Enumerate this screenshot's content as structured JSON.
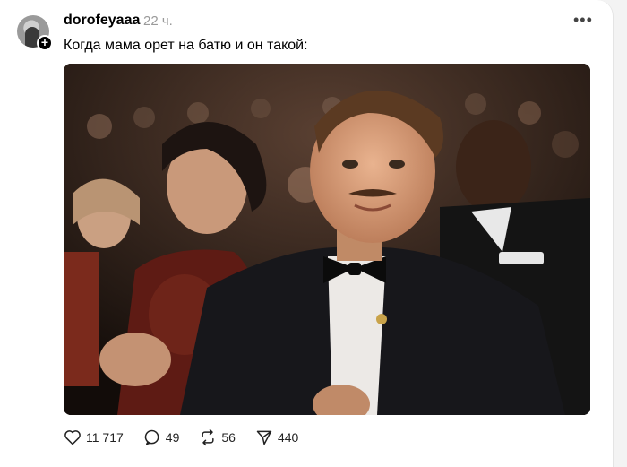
{
  "post": {
    "username": "dorofeyaaa",
    "time": "22 ч.",
    "text": "Когда мама орет на батю и он такой:",
    "more_icon": "more-horizontal-icon",
    "avatar_plus": "+",
    "image_icon": "photo-audience-scene"
  },
  "actions": {
    "likes": "11 717",
    "comments": "49",
    "reposts": "56",
    "shares": "440"
  }
}
